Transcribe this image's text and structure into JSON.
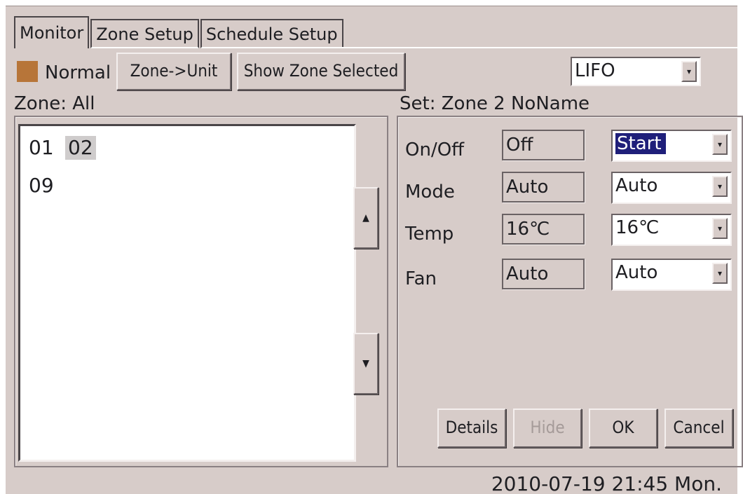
{
  "tabs": [
    {
      "label": "Monitor",
      "active": true
    },
    {
      "label": "Zone Setup",
      "active": false
    },
    {
      "label": "Schedule Setup",
      "active": false
    }
  ],
  "status": {
    "label": "Normal",
    "color": "#b77539"
  },
  "toolbar": {
    "zone_to_unit_label": "Zone->Unit",
    "show_zone_selected_label": "Show Zone Selected",
    "order_select_value": "LIFO"
  },
  "zone": {
    "heading": "Zone: All",
    "items": [
      "01",
      "02",
      "09"
    ],
    "selected": "02",
    "scroll_up_icon": "▲",
    "scroll_down_icon": "▼"
  },
  "set": {
    "heading": "Set: Zone 2 NoName",
    "rows": [
      {
        "label": "On/Off",
        "current": "Off",
        "select": "Start"
      },
      {
        "label": "Mode",
        "current": "Auto",
        "select": "Auto"
      },
      {
        "label": "Temp",
        "current": "16℃",
        "select": "16℃"
      },
      {
        "label": "Fan",
        "current": "Auto",
        "select": "Auto"
      }
    ],
    "buttons": {
      "details": "Details",
      "hide": "Hide",
      "ok": "OK",
      "cancel": "Cancel"
    }
  },
  "datetime": "2010-07-19 21:45 Mon.",
  "dropdown_icon": "▾"
}
